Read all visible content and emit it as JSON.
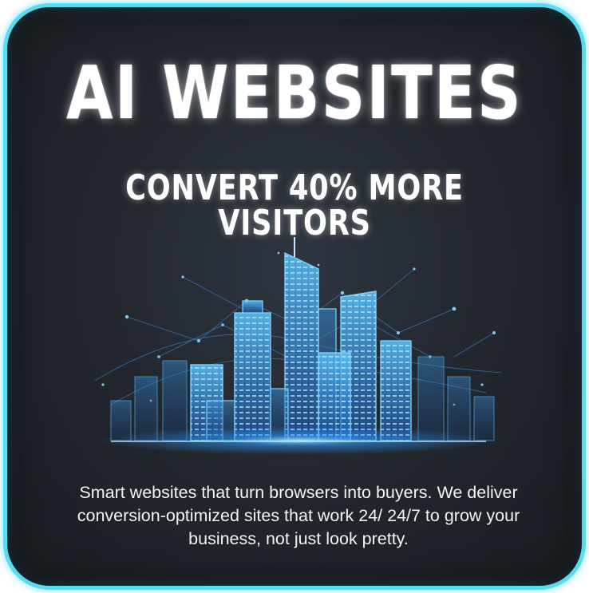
{
  "headline": "AI WEBSITES",
  "subheadline": "CONVERT 40% MORE VISITORS",
  "illustration": "glowing-city-skyline-icon",
  "description": "Smart websites that turn browsers into buyers. We deliver conversion-optimized sites that work 24/ 24/7 to grow your business, not just look pretty.",
  "colors": {
    "border": "#57dcf3",
    "background": "#23282f",
    "skyline_glow": "#2f9bff",
    "text": "#ffffff"
  }
}
